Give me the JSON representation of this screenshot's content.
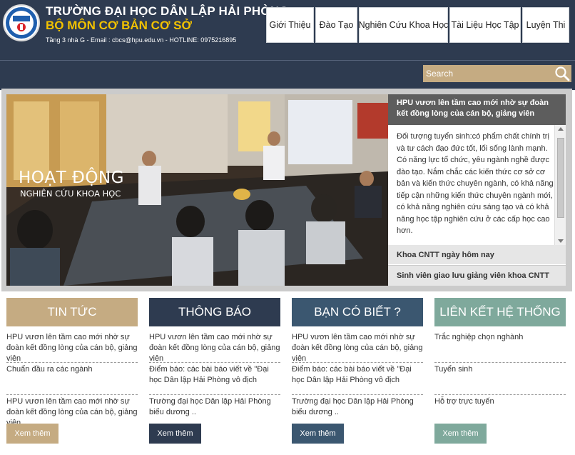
{
  "header": {
    "school_name": "TRƯỜNG ĐẠI HỌC DÂN LẬP HẢI PHÒNG",
    "department": "BỘ MÔN CƠ BẢN CƠ SỞ",
    "contact": "Tầng 3 nhà G - Email : cbcs@hpu.edu.vn - HOTLINE: 0975216895",
    "logo_icon": "university-seal-icon"
  },
  "nav": {
    "items": [
      "Giới Thiệu",
      "Đào Tạo",
      "Nghiên Cứu Khoa Học",
      "Tài Liệu Học Tập",
      "Luyện Thi"
    ]
  },
  "search": {
    "placeholder": "Search",
    "icon": "search-icon"
  },
  "slider": {
    "photo_title": "HOẠT ĐỘNG",
    "photo_subtitle": "NGHIÊN CỨU KHOA HỌC",
    "active_headline": "HPU vươn lên tầm cao mới nhờ sự đoàn kết đồng lòng của cán bộ, giảng viên",
    "active_excerpt": "Đối tượng tuyển sinh:có phẩm chất chính trị và tư cách đạo đức tốt, lối sống lành mạnh. Có năng lực tổ chức, yêu ngành nghề được đào tạo. Nắm chắc các kiến thức cơ sở cơ bản và kiến thức chuyên ngành, có khả năng tiếp cận những kiến thức chuyên ngành mới, có khả năng nghiên cứu sáng tạo và có khả năng học tập nghiên cứu ở các cấp học cao hơn.",
    "other_headlines": [
      "Khoa CNTT ngày hôm nay",
      "Sinh viên giao lưu giảng viên khoa CNTT"
    ]
  },
  "columns": [
    {
      "title": "TIN TỨC",
      "items": [
        "HPU vươn lên tầm cao mới nhờ sự đoàn kết đồng lòng của cán bộ, giảng viên",
        "Chuẩn đầu ra các ngành",
        "HPU vươn lên tầm cao mới nhờ sự đoàn kết đồng lòng của cán bộ, giảng viên"
      ],
      "more_label": "Xem thêm"
    },
    {
      "title": "THÔNG BÁO",
      "items": [
        "HPU vươn lên tầm cao mới nhờ sự đoàn kết đồng lòng của cán bộ, giảng viên",
        "Điểm báo: các bài báo viết về \"Đại học Dân lập Hải Phòng vô địch",
        "Trường đại học Dân lập Hải Phòng biểu dương .."
      ],
      "more_label": "Xem thêm"
    },
    {
      "title": "BẠN CÓ BIẾT ?",
      "items": [
        "HPU vươn lên tầm cao mới nhờ sự đoàn kết đồng lòng của cán bộ, giảng viên",
        "Điểm báo: các bài báo viết về \"Đại học Dân lập Hải Phòng vô địch",
        "Trường đại học Dân lập Hải Phòng biểu dương .."
      ],
      "more_label": "Xem thêm"
    },
    {
      "title": "LIÊN KẾT HỆ THỐNG",
      "items": [
        "Trắc nghiệp chọn nghành",
        "Tuyển sinh",
        "Hỗ trợ trực tuyến"
      ],
      "more_label": "Xem thêm"
    }
  ],
  "colors": {
    "header_bg": "#2e3b50",
    "accent_tan": "#c5ab82",
    "accent_navy": "#2e3b50",
    "accent_slate": "#3b5770",
    "accent_sage": "#7fa99c",
    "dept_yellow": "#f2c200"
  }
}
